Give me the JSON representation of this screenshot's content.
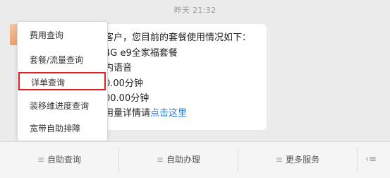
{
  "timestamp": "昨天 21:32",
  "message": {
    "lines": [
      "客户，您目前的套餐使用情况如下：",
      "4G e9全家福套餐",
      "内语音",
      "0.00分钟",
      "00.00分钟"
    ],
    "last_prefix": "用量详情请",
    "last_link": "点击这里"
  },
  "menu": {
    "items": [
      {
        "label": "费用查询"
      },
      {
        "label": "套餐/流量查询"
      },
      {
        "label": "详单查询",
        "highlighted": true
      },
      {
        "label": "装移维进度查询"
      },
      {
        "label": "宽带自助排障"
      }
    ]
  },
  "bottom_tabs": [
    {
      "label": "自助查询"
    },
    {
      "label": "自助办理"
    },
    {
      "label": "更多服务"
    }
  ],
  "colors": {
    "background": "#ebebeb",
    "link": "#2f7fd8",
    "highlight_border": "#e02020"
  },
  "icons": {
    "menu": "hamburger-icon",
    "keyboard": "keyboard-toggle-icon"
  }
}
